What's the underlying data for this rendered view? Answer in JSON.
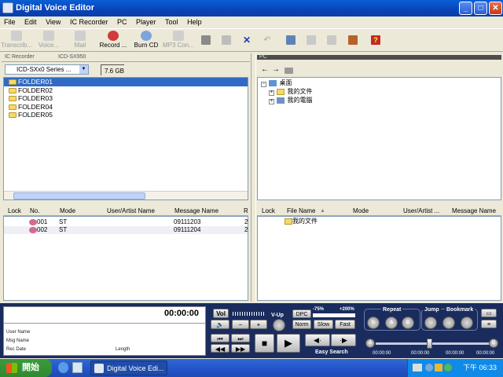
{
  "window": {
    "title": "Digital Voice Editor",
    "min": "_",
    "max": "□",
    "close": "✕"
  },
  "menu": [
    "File",
    "Edit",
    "View",
    "IC Recorder",
    "PC",
    "Player",
    "Tool",
    "Help"
  ],
  "toolbar": {
    "transcribe": "Transcrib...",
    "voice": "Voice...",
    "mail": "Mail",
    "record": "Record ...",
    "burn_cd": "Burn CD",
    "mp3": "MP3 Con..."
  },
  "ic_recorder": {
    "pane_title": "IC Recorder",
    "model_label": "ICD-SX950",
    "device_select": "ICD-SXx0 Series ...",
    "capacity": "7.6 GB",
    "folders": [
      "FOLDER01",
      "FOLDER02",
      "FOLDER03",
      "FOLDER04",
      "FOLDER05"
    ],
    "columns": [
      "Lock",
      "No.",
      "Mode",
      "User/Artist Name",
      "Message Name",
      "R"
    ],
    "rows": [
      {
        "no": "001",
        "mode": "ST",
        "message": "09111203",
        "r": "2"
      },
      {
        "no": "002",
        "mode": "ST",
        "message": "09111204",
        "r": "2"
      }
    ]
  },
  "pc": {
    "pane_title": "PC",
    "tree": {
      "root": "桌面",
      "children": [
        "我的文件",
        "我的電腦"
      ]
    },
    "columns": [
      "Lock",
      "File Name",
      "Mode",
      "User/Artist ...",
      "Message Name"
    ],
    "rows": [
      {
        "file": "我的文件"
      }
    ]
  },
  "player": {
    "time": "00:00:00",
    "user_name_label": "User Name",
    "msg_name_label": "Msg Name",
    "rec_date_label": "Rec Date",
    "length_label": "Length",
    "vol_label": "Vol",
    "vup_label": "V-Up",
    "dpc_label": "DPC",
    "dpc_min": "-75%",
    "dpc_max": "+200%",
    "norm": "Norm",
    "slow": "Slow",
    "fast": "Fast",
    "easy_search": "Easy Search",
    "repeat_label": "Repeat",
    "jump_label": "Jump",
    "bookmark_label": "Bookmark",
    "a_label": "A",
    "b_label": "B",
    "start_time": "00:00:00",
    "t1": "00:00:00",
    "t2": "00:00:00",
    "end_time": "00:00:00",
    "minus": "−",
    "plus": "+",
    "position_fraction": 0.47
  },
  "taskbar": {
    "start": "開始",
    "task": "Digital Voice Edi...",
    "clock": "下午 06:33"
  },
  "colors": {
    "title_bar": "#0a5fd6",
    "selection": "#316ac5",
    "player_bg": "#1a2c5e",
    "taskbar": "#2456c9"
  }
}
